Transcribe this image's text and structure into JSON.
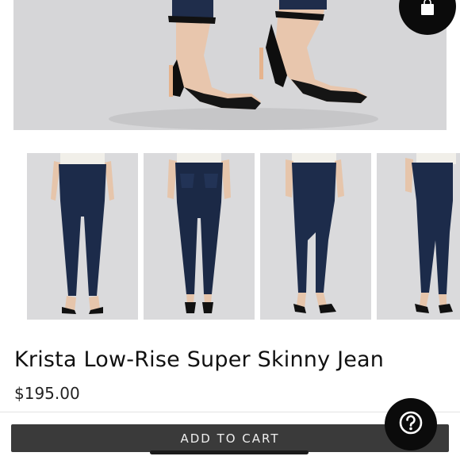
{
  "product": {
    "title": "Krista Low-Rise Super Skinny Jean",
    "price": "$195.00"
  },
  "actions": {
    "add_to_cart_label": "ADD TO CART"
  },
  "icons": {
    "cart": "shopping-bag-icon",
    "help": "question-mark-icon"
  },
  "gallery": {
    "thumbnail_count": 4,
    "views": [
      "front",
      "back",
      "side",
      "side-close"
    ]
  },
  "colors": {
    "denim": "#1c2b4a",
    "button_bg": "#3a3a3a",
    "fab_bg": "#0b0b0b"
  }
}
